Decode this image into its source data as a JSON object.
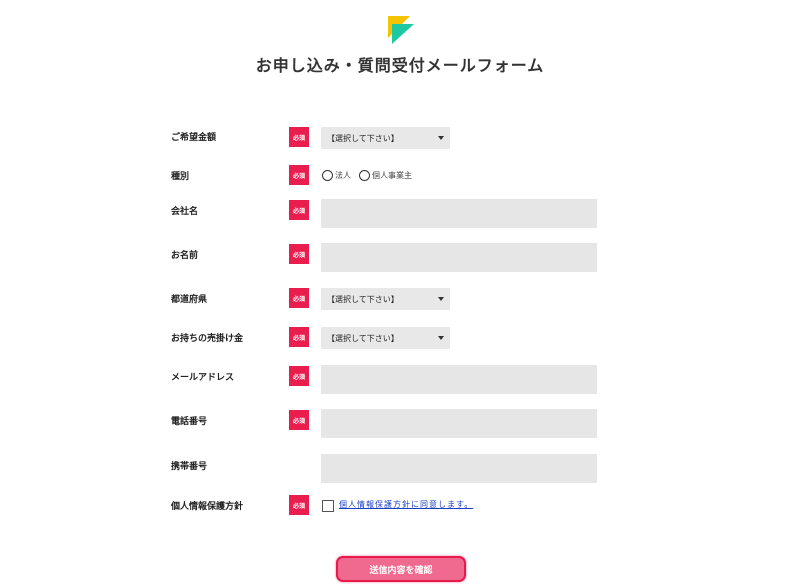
{
  "page": {
    "title": "お申し込み・質問受付メールフォーム"
  },
  "colors": {
    "badge": "#e91e4f",
    "logo_yellow": "#f5c400",
    "logo_teal": "#1ec8a0",
    "submit_bg": "#f06a8f",
    "submit_border": "#e8194d",
    "link": "#1a3fc2"
  },
  "required_label": "必須",
  "fields": {
    "amount": {
      "label": "ご希望金額",
      "value": "【選択して下さい】"
    },
    "type": {
      "label": "種別",
      "options": [
        "法人",
        "個人事業主"
      ]
    },
    "company": {
      "label": "会社名",
      "value": ""
    },
    "name": {
      "label": "お名前",
      "value": ""
    },
    "prefecture": {
      "label": "都道府県",
      "value": "【選択して下さい】"
    },
    "receivables": {
      "label": "お持ちの売掛け金",
      "value": "【選択して下さい】"
    },
    "email": {
      "label": "メールアドレス",
      "value": ""
    },
    "phone": {
      "label": "電話番号",
      "value": ""
    },
    "mobile": {
      "label": "携帯番号",
      "value": ""
    },
    "privacy": {
      "label": "個人情報保護方針",
      "agree_text": "個人情報保護方針に同意します。"
    }
  },
  "submit": {
    "label": "送信内容を確認"
  }
}
